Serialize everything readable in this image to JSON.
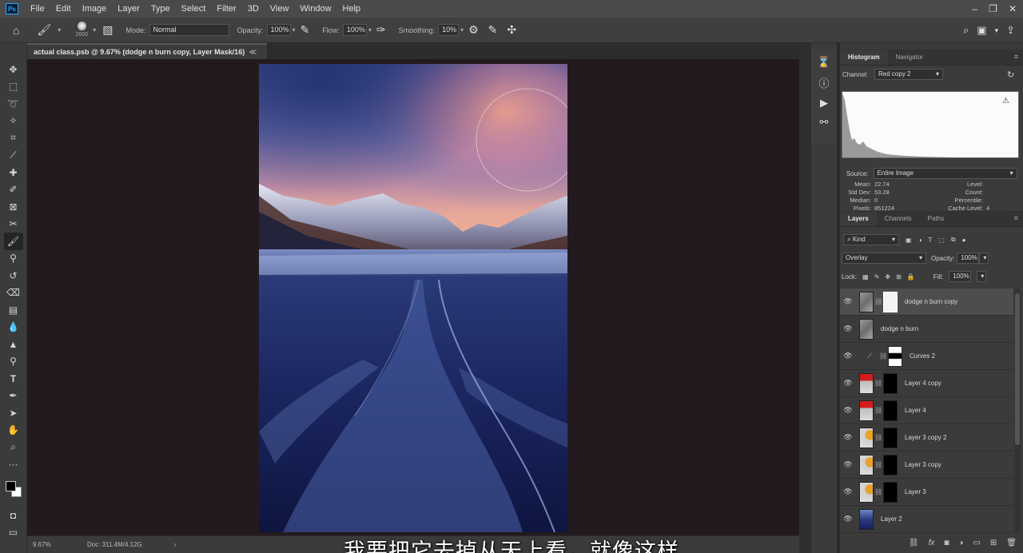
{
  "app": {
    "logo": "Ps",
    "menu": [
      "File",
      "Edit",
      "Image",
      "Layer",
      "Type",
      "Select",
      "Filter",
      "3D",
      "View",
      "Window",
      "Help"
    ]
  },
  "options": {
    "brush_size": "2600",
    "mode_label": "Mode:",
    "mode_value": "Normal",
    "opacity_label": "Opacity:",
    "opacity_value": "100%",
    "flow_label": "Flow:",
    "flow_value": "100%",
    "smoothing_label": "Smoothing:",
    "smoothing_value": "10%"
  },
  "document": {
    "tab_title": "actual class.psb @ 9.67% (dodge n burn copy, Layer Mask/16)",
    "tab_close": "≪",
    "zoom": "9.67%",
    "doc_info": "Doc: 311.4M/4.12G",
    "subtitle": "我要把它去掉从天上看，就像这样"
  },
  "histogram": {
    "tabs": [
      "Histogram",
      "Navigator"
    ],
    "channel_label": "Channel:",
    "channel_value": "Red copy 2",
    "source_label": "Source:",
    "source_value": "Entire Image",
    "stats": [
      {
        "k": "Mean:",
        "v": "22.74",
        "k2": "Level:",
        "v2": ""
      },
      {
        "k": "Std Dev:",
        "v": "53.28",
        "k2": "Count:",
        "v2": ""
      },
      {
        "k": "Median:",
        "v": "0",
        "k2": "Percentile:",
        "v2": ""
      },
      {
        "k": "Pixels:",
        "v": "851224",
        "k2": "Cache Level:",
        "v2": "4"
      }
    ]
  },
  "layers": {
    "tabs": [
      "Layers",
      "Channels",
      "Paths"
    ],
    "filter_value": "Kind",
    "blend_value": "Overlay",
    "opacity_label": "Opacity:",
    "opacity_value": "100%",
    "lock_label": "Lock:",
    "fill_label": "Fill:",
    "fill_value": "100%",
    "items": [
      {
        "name": "dodge n burn copy",
        "thumb": "gray",
        "mask": "white-mask",
        "selected": true
      },
      {
        "name": "dodge n burn",
        "thumb": "gray",
        "mask": "",
        "selected": false
      },
      {
        "name": "Curves 2",
        "thumb": "curves-adjustment",
        "mask": "black-white-mask",
        "selected": false
      },
      {
        "name": "Layer 4 copy",
        "thumb": "red-top",
        "mask": "black-mask",
        "selected": false
      },
      {
        "name": "Layer 4",
        "thumb": "red-top",
        "mask": "black-mask",
        "selected": false
      },
      {
        "name": "Layer 3 copy 2",
        "thumb": "orange-dot",
        "mask": "black-mask",
        "selected": false
      },
      {
        "name": "Layer 3 copy",
        "thumb": "orange-dot",
        "mask": "black-mask",
        "selected": false
      },
      {
        "name": "Layer 3",
        "thumb": "orange-dot",
        "mask": "black-mask",
        "selected": false
      },
      {
        "name": "Layer 2",
        "thumb": "photo",
        "mask": "",
        "selected": false
      }
    ]
  },
  "colors": {
    "canvas_bg": "#231a1f",
    "panel_bg": "#3b3b3b",
    "accent": "#31a8ff"
  }
}
